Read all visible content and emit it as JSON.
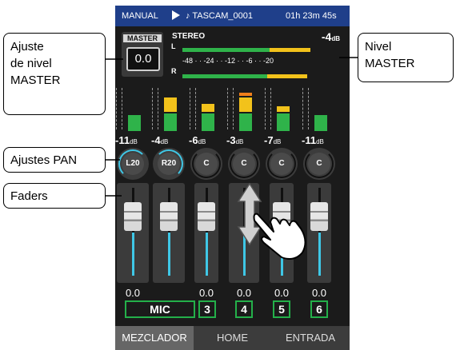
{
  "statusbar": {
    "mode": "MANUAL",
    "play_icon": "play-icon",
    "file": "♪ TASCAM_0001",
    "time": "01h 23m 45s"
  },
  "master": {
    "label": "MASTER",
    "value": "0.0",
    "stereo": "STEREO",
    "level_num": "-4",
    "level_unit": "dB",
    "left_label": "L",
    "right_label": "R",
    "scale": "-48 · · -24 · · -12 · · -6 · · -20",
    "meter_left": 0.85,
    "meter_right": 0.83
  },
  "channels": [
    {
      "name": "MIC",
      "level": "-11",
      "pan": "L20",
      "fader_value": "0.0",
      "meter": 0.35
    },
    {
      "name": "",
      "level": "-4",
      "pan": "R20",
      "fader_value": "",
      "meter": 0.72
    },
    {
      "name": "3",
      "level": "-6",
      "pan": "C",
      "fader_value": "0.0",
      "meter": 0.58
    },
    {
      "name": "4",
      "level": "-3",
      "pan": "C",
      "fader_value": "0.0",
      "meter": 0.82
    },
    {
      "name": "5",
      "level": "-7",
      "pan": "C",
      "fader_value": "0.0",
      "meter": 0.52
    },
    {
      "name": "6",
      "level": "-11",
      "pan": "C",
      "fader_value": "0.0",
      "meter": 0.35
    }
  ],
  "level_unit": "dB",
  "tabs": [
    {
      "label": "MEZCLADOR",
      "active": true
    },
    {
      "label": "HOME",
      "active": false
    },
    {
      "label": "ENTRADA",
      "active": false
    }
  ],
  "callouts": {
    "master_adjust": [
      "Ajuste",
      "de nivel",
      "MASTER"
    ],
    "master_level": [
      "Nivel",
      "MASTER"
    ],
    "pan": "Ajustes PAN",
    "faders": "Faders"
  },
  "colors": {
    "statusbar": "#1f3f8a",
    "meter_green": "#2fb34a",
    "meter_yellow": "#f2c21b",
    "meter_orange": "#f07f1b",
    "fader_cyan": "#3fc7e6",
    "channel_border": "#24b04a"
  }
}
